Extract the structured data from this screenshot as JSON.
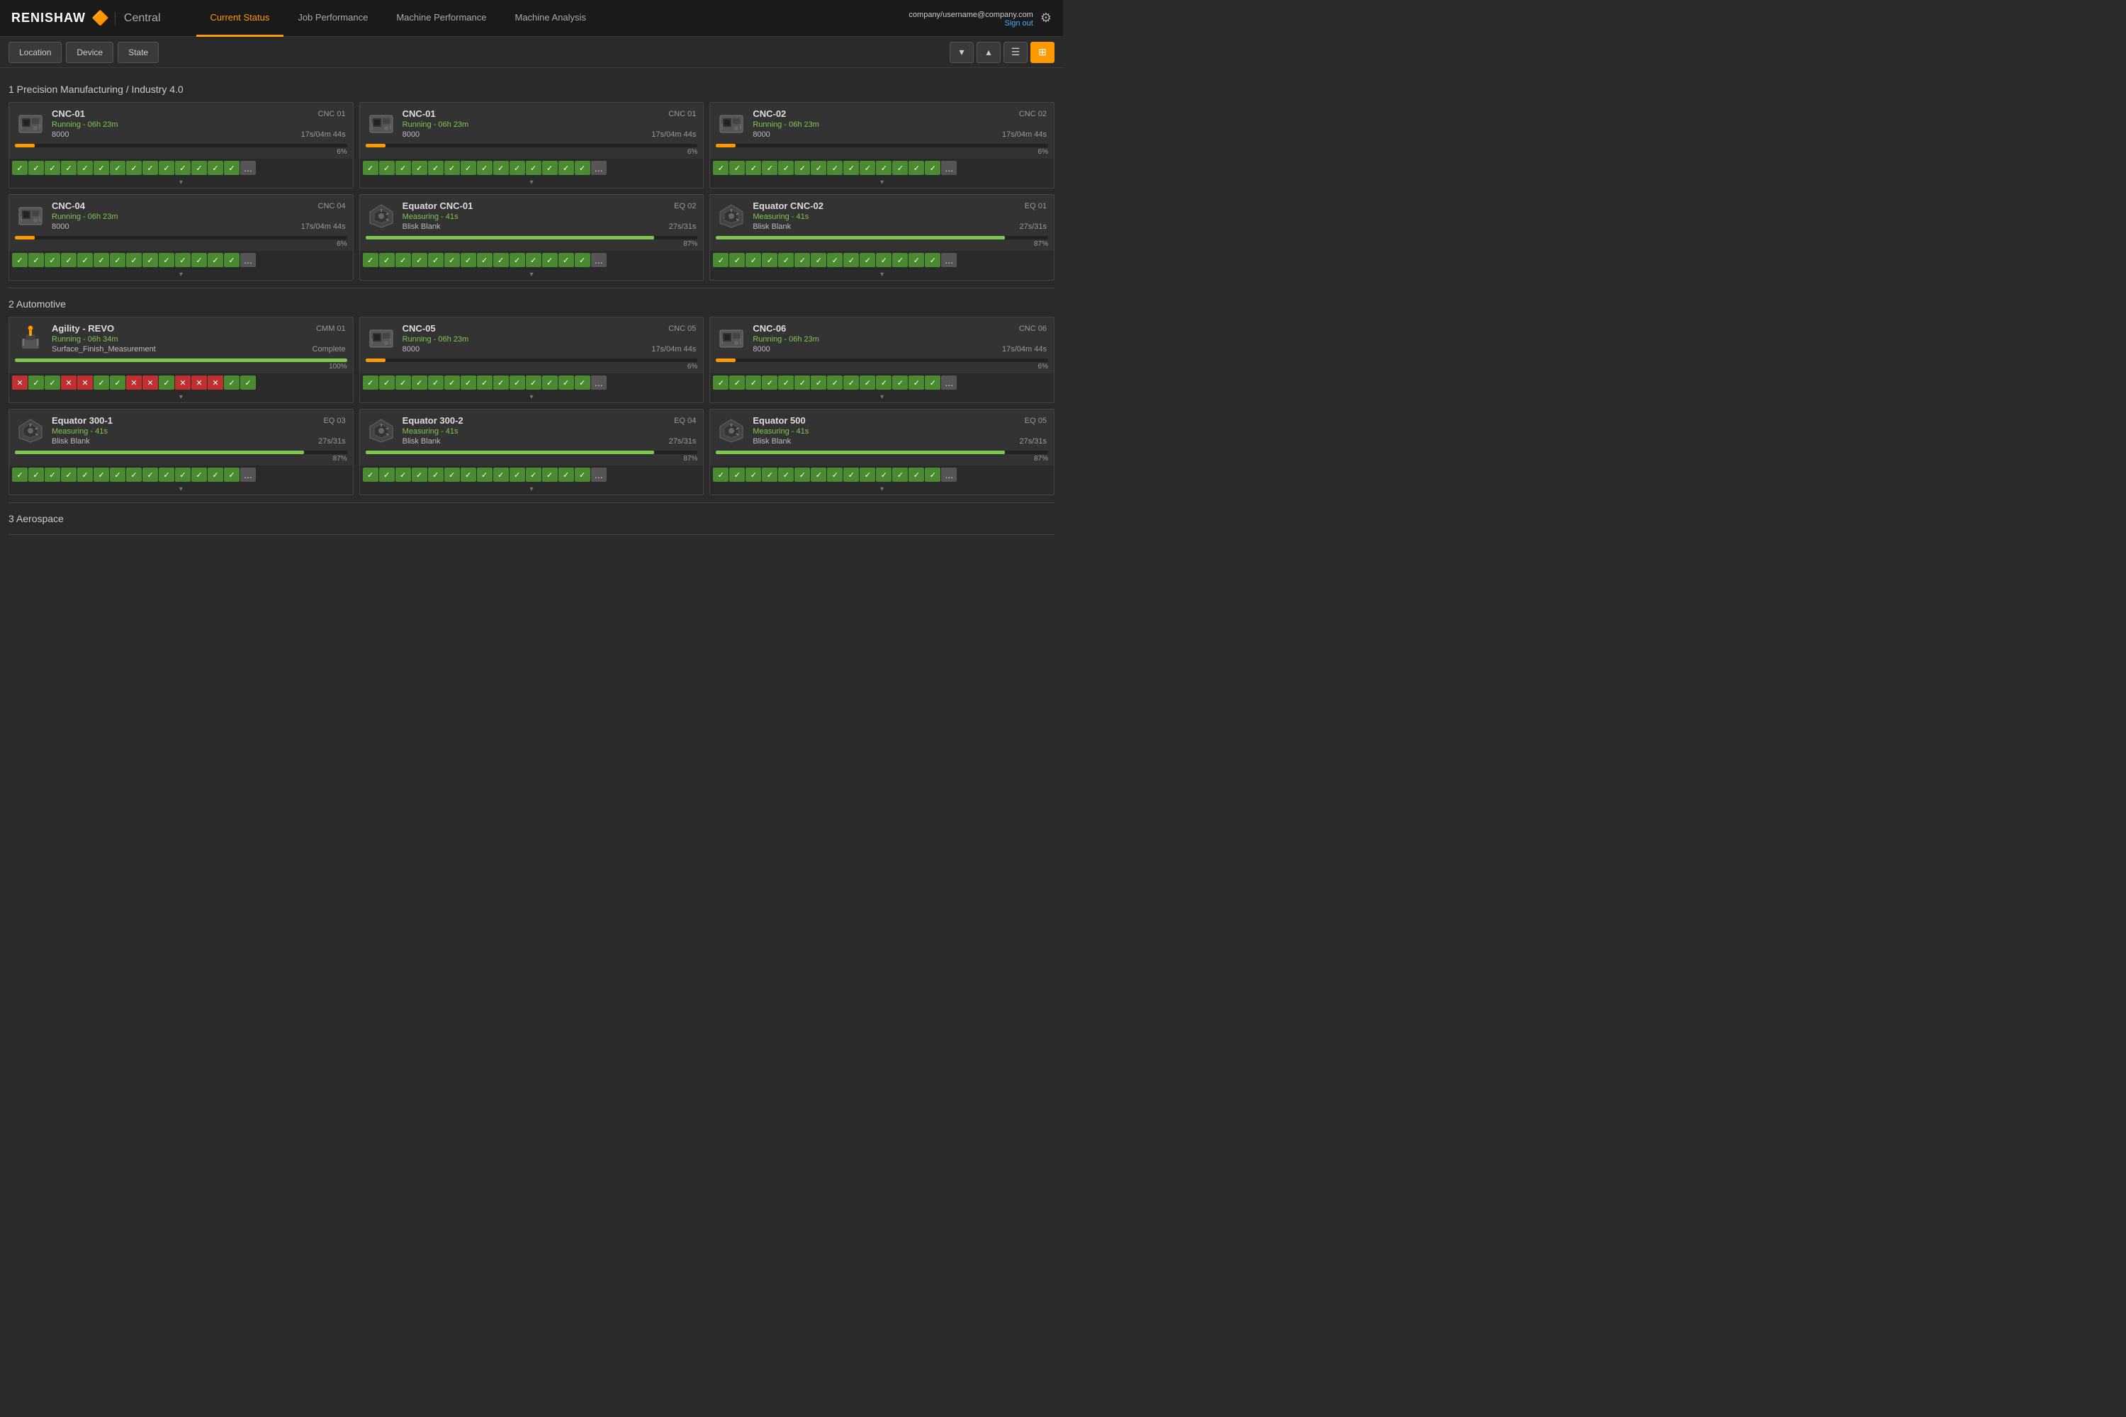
{
  "header": {
    "logo": "RENISHAW",
    "logo_icon": "🔶",
    "central": "Central",
    "user_email": "company/username@company.com",
    "sign_out": "Sign out",
    "nav_tabs": [
      {
        "label": "Current Status",
        "active": true
      },
      {
        "label": "Job Performance",
        "active": false
      },
      {
        "label": "Machine Performance",
        "active": false
      },
      {
        "label": "Machine Analysis",
        "active": false
      }
    ]
  },
  "toolbar": {
    "location_btn": "Location",
    "device_btn": "Device",
    "state_btn": "State"
  },
  "sections": [
    {
      "id": "precision",
      "title": "1 Precision Manufacturing / Industry 4.0",
      "machines": [
        {
          "name": "CNC-01",
          "type": "CNC 01",
          "status": "Running - 06h 23m",
          "value": "8000",
          "time": "17s/04m 44s",
          "pct": 6,
          "pct_label": "6%",
          "bar_color": "orange",
          "icon_type": "cnc",
          "checks": [
            "ok",
            "ok",
            "ok",
            "ok",
            "ok",
            "ok",
            "ok",
            "ok",
            "ok",
            "ok",
            "ok",
            "ok",
            "ok",
            "ok",
            "more"
          ]
        },
        {
          "name": "CNC-01",
          "type": "CNC 01",
          "status": "Running - 06h 23m",
          "value": "8000",
          "time": "17s/04m 44s",
          "pct": 6,
          "pct_label": "6%",
          "bar_color": "orange",
          "icon_type": "cnc",
          "checks": [
            "ok",
            "ok",
            "ok",
            "ok",
            "ok",
            "ok",
            "ok",
            "ok",
            "ok",
            "ok",
            "ok",
            "ok",
            "ok",
            "ok",
            "more"
          ]
        },
        {
          "name": "CNC-02",
          "type": "CNC 02",
          "status": "Running - 06h 23m",
          "value": "8000",
          "time": "17s/04m 44s",
          "pct": 6,
          "pct_label": "6%",
          "bar_color": "orange",
          "icon_type": "cnc",
          "checks": [
            "ok",
            "ok",
            "ok",
            "ok",
            "ok",
            "ok",
            "ok",
            "ok",
            "ok",
            "ok",
            "ok",
            "ok",
            "ok",
            "ok",
            "more"
          ]
        },
        {
          "name": "CNC-04",
          "type": "CNC 04",
          "status": "Running - 06h 23m",
          "value": "8000",
          "time": "17s/04m 44s",
          "pct": 6,
          "pct_label": "6%",
          "bar_color": "orange",
          "icon_type": "cnc",
          "checks": [
            "ok",
            "ok",
            "ok",
            "ok",
            "ok",
            "ok",
            "ok",
            "ok",
            "ok",
            "ok",
            "ok",
            "ok",
            "ok",
            "ok",
            "more"
          ]
        },
        {
          "name": "Equator CNC-01",
          "type": "EQ 02",
          "status": "Measuring - 41s",
          "value": "Blisk Blank",
          "time": "27s/31s",
          "pct": 87,
          "pct_label": "87%",
          "bar_color": "green",
          "icon_type": "eq",
          "checks": [
            "ok",
            "ok",
            "ok",
            "ok",
            "ok",
            "ok",
            "ok",
            "ok",
            "ok",
            "ok",
            "ok",
            "ok",
            "ok",
            "ok",
            "more"
          ]
        },
        {
          "name": "Equator CNC-02",
          "type": "EQ 01",
          "status": "Measuring - 41s",
          "value": "Blisk Blank",
          "time": "27s/31s",
          "pct": 87,
          "pct_label": "87%",
          "bar_color": "green",
          "icon_type": "eq",
          "checks": [
            "ok",
            "ok",
            "ok",
            "ok",
            "ok",
            "ok",
            "ok",
            "ok",
            "ok",
            "ok",
            "ok",
            "ok",
            "ok",
            "ok",
            "more"
          ]
        }
      ]
    },
    {
      "id": "automotive",
      "title": "2 Automotive",
      "machines": [
        {
          "name": "Agility - REVO",
          "type": "CMM 01",
          "status": "Running - 06h 34m",
          "value": "Surface_Finish_Measurement",
          "time": "Complete",
          "pct": 100,
          "pct_label": "100%",
          "bar_color": "green",
          "icon_type": "agility",
          "checks": [
            "fail",
            "ok",
            "ok",
            "fail",
            "fail",
            "ok",
            "ok",
            "fail",
            "fail",
            "ok",
            "fail",
            "fail",
            "fail",
            "ok",
            "ok"
          ]
        },
        {
          "name": "CNC-05",
          "type": "CNC 05",
          "status": "Running - 06h 23m",
          "value": "8000",
          "time": "17s/04m 44s",
          "pct": 6,
          "pct_label": "6%",
          "bar_color": "orange",
          "icon_type": "cnc",
          "checks": [
            "ok",
            "ok",
            "ok",
            "ok",
            "ok",
            "ok",
            "ok",
            "ok",
            "ok",
            "ok",
            "ok",
            "ok",
            "ok",
            "ok",
            "more"
          ]
        },
        {
          "name": "CNC-06",
          "type": "CNC 06",
          "status": "Running - 06h 23m",
          "value": "8000",
          "time": "17s/04m 44s",
          "pct": 6,
          "pct_label": "6%",
          "bar_color": "orange",
          "icon_type": "cnc",
          "checks": [
            "ok",
            "ok",
            "ok",
            "ok",
            "ok",
            "ok",
            "ok",
            "ok",
            "ok",
            "ok",
            "ok",
            "ok",
            "ok",
            "ok",
            "more"
          ]
        },
        {
          "name": "Equator 300-1",
          "type": "EQ 03",
          "status": "Measuring - 41s",
          "value": "Blisk Blank",
          "time": "27s/31s",
          "pct": 87,
          "pct_label": "87%",
          "bar_color": "green",
          "icon_type": "eq",
          "checks": [
            "ok",
            "ok",
            "ok",
            "ok",
            "ok",
            "ok",
            "ok",
            "ok",
            "ok",
            "ok",
            "ok",
            "ok",
            "ok",
            "ok",
            "more"
          ]
        },
        {
          "name": "Equator 300-2",
          "type": "EQ 04",
          "status": "Measuring - 41s",
          "value": "Blisk Blank",
          "time": "27s/31s",
          "pct": 87,
          "pct_label": "87%",
          "bar_color": "green",
          "icon_type": "eq",
          "checks": [
            "ok",
            "ok",
            "ok",
            "ok",
            "ok",
            "ok",
            "ok",
            "ok",
            "ok",
            "ok",
            "ok",
            "ok",
            "ok",
            "ok",
            "more"
          ]
        },
        {
          "name": "Equator 500",
          "type": "EQ 05",
          "status": "Measuring - 41s",
          "value": "Blisk Blank",
          "time": "27s/31s",
          "pct": 87,
          "pct_label": "87%",
          "bar_color": "green",
          "icon_type": "eq",
          "checks": [
            "ok",
            "ok",
            "ok",
            "ok",
            "ok",
            "ok",
            "ok",
            "ok",
            "ok",
            "ok",
            "ok",
            "ok",
            "ok",
            "ok",
            "more"
          ]
        }
      ]
    },
    {
      "id": "aerospace",
      "title": "3 Aerospace",
      "machines": []
    }
  ],
  "icons": {
    "chevron_down": "▾",
    "chevron_up": "▴",
    "list_view": "☰",
    "grid_view": "⊞",
    "check": "✓",
    "cross": "✕",
    "more": "...",
    "gear": "⚙"
  }
}
